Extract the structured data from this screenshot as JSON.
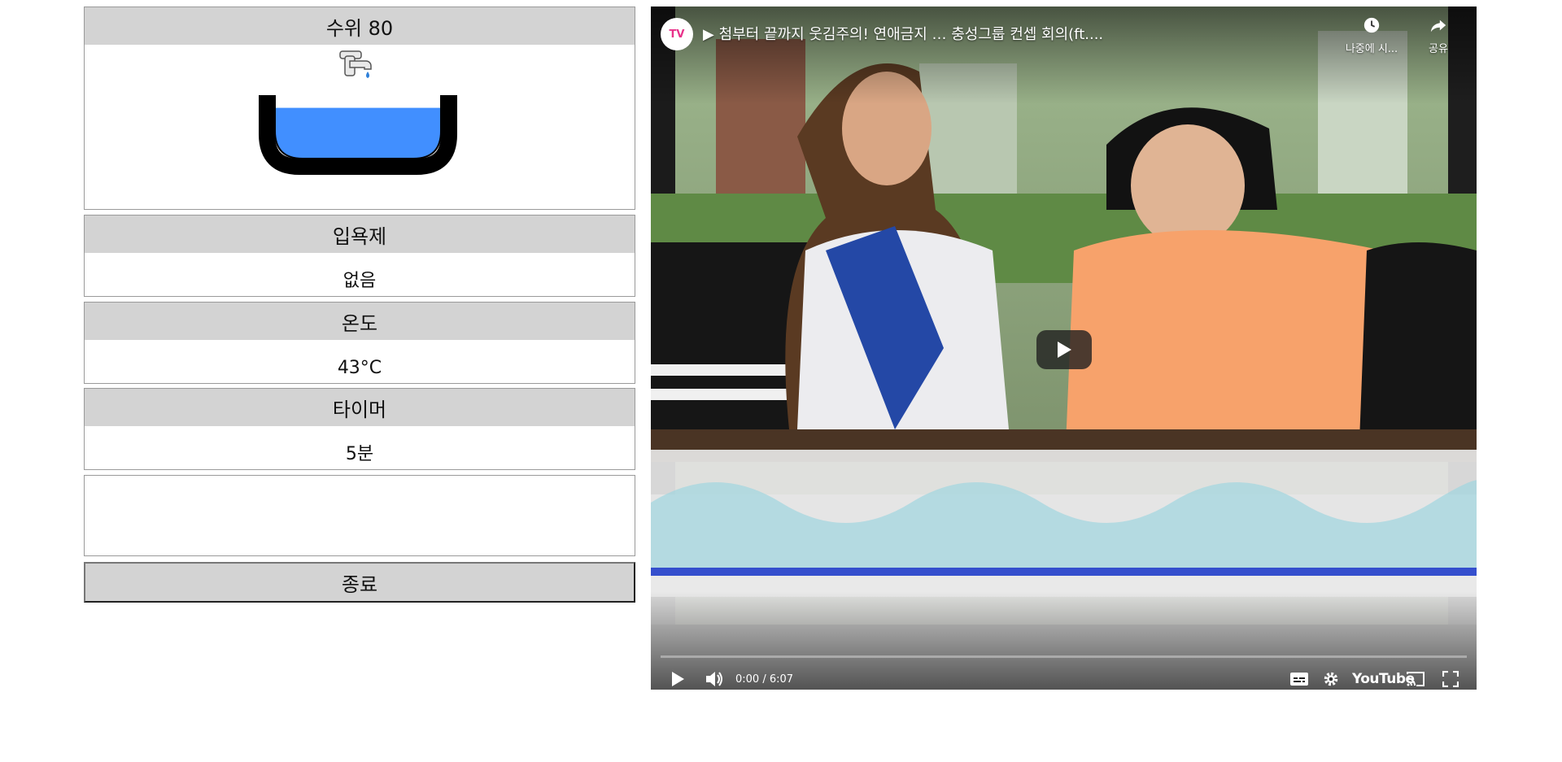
{
  "panels": {
    "water": {
      "title": "수위 80",
      "level": 80
    },
    "bath_salt": {
      "title": "입욕제",
      "value": "없음"
    },
    "temperature": {
      "title": "온도",
      "value": "43°C"
    },
    "timer": {
      "title": "타이머",
      "value": "5분"
    }
  },
  "end_button": {
    "label": "종료"
  },
  "video": {
    "channel_badge": "TV",
    "title": "▶ 첨부터 끝까지 웃김주의! 연애금지 … 충성그룹 컨셉 회의(ft....",
    "watch_later_label": "나중에 시...",
    "share_label": "공유",
    "time_display": "0:00 / 6:07",
    "progress": 0,
    "brand_label": "YouTube"
  },
  "colors": {
    "water": "#418fff",
    "panel_head": "#d3d3d3",
    "tub": "#000000"
  },
  "icons": {
    "faucet": "faucet-icon",
    "play": "play-icon",
    "volume": "volume-icon",
    "captions": "captions-icon",
    "settings": "gear-icon",
    "cast": "cast-icon",
    "fullscreen": "fullscreen-icon",
    "clock": "clock-icon",
    "share": "share-icon"
  }
}
